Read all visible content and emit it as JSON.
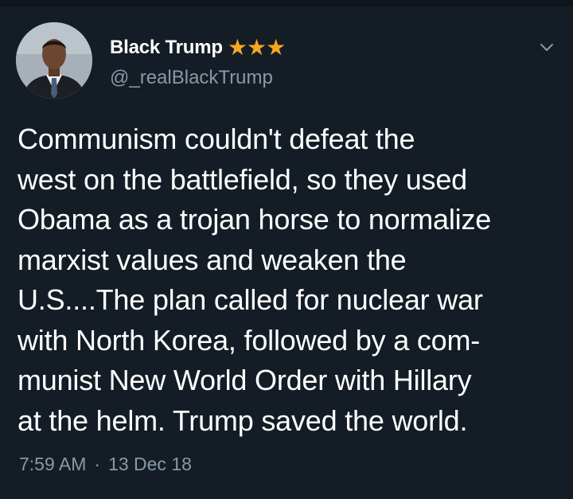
{
  "tweet": {
    "author": {
      "display_name": "Black Trump",
      "badge_icons": [
        "star-icon",
        "star-icon",
        "star-icon"
      ],
      "handle": "@_realBlackTrump",
      "avatar_icon": "avatar-photo"
    },
    "menu_icon": "chevron-down-icon",
    "text_lines": [
      "Communism couldn't defeat the",
      "west on the battlefield, so they used",
      "Obama as a trojan horse to normalize",
      "marxist values and weaken the",
      "U.S....The plan called for nuclear war",
      "with North Korea, followed by a com-",
      "munist New World Order with Hillary",
      "at the helm. Trump saved the world."
    ],
    "time": "7:59 AM",
    "separator": "·",
    "date": "13 Dec 18"
  },
  "colors": {
    "background": "#141d26",
    "text": "#ffffff",
    "secondary_text": "#8899a6",
    "star": "#f5a623"
  }
}
